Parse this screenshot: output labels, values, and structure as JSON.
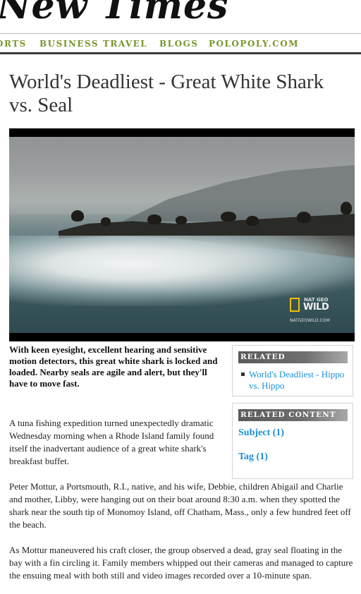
{
  "masthead": {
    "title": "New Times"
  },
  "nav": {
    "items": [
      {
        "label": "ORTS"
      },
      {
        "label": "BUSINESS"
      },
      {
        "label": "TRAVEL"
      },
      {
        "label": "BLOGS"
      },
      {
        "label": "POLOPOLY.COM"
      }
    ]
  },
  "article": {
    "headline": "World's Deadliest - Great White Shark vs. Seal",
    "caption": "With keen eyesight, excellent hearing and sensitive motion detectors, this great white shark is locked and loaded. Nearby seals are agile and alert, but they'll have to move fast.",
    "paragraphs": [
      "A tuna fishing expedition turned unexpectedly dramatic Wednesday morning when a Rhode Island family found itself the inadvertant audience of a great white shark's breakfast buffet.",
      "Peter Mottur, a Portsmouth, R.I., native, and his wife, Debbie, children Abigail and Charlie and mother, Libby, were hanging out on their boat around 8:30 a.m. when they spotted the shark near the south tip of Monomoy Island, off Chatham, Mass., only a few hundred feet off the beach.",
      "As Mottur maneuvered his craft closer, the group observed a dead, gray seal floating in the bay with a fin circling it. Family members whipped out their cameras and managed to capture the ensuing meal with both still and video images recorded over a 10-minute span."
    ]
  },
  "video": {
    "logo_small": "NAT GEO",
    "logo_large": "WILD",
    "logo_url": "NATGEOWILD.COM"
  },
  "related": {
    "header": "RELATED",
    "items": [
      {
        "label": "World's Deadliest - Hippo vs. Hippo"
      }
    ]
  },
  "related_content": {
    "header": "RELATED CONTENT",
    "links": [
      {
        "label": "Subject (1)"
      },
      {
        "label": "Tag (1)"
      }
    ]
  },
  "colors": {
    "nav_green": "#76962a",
    "link_blue": "#1a8fd4",
    "header_gray": "#5a5a5a"
  }
}
